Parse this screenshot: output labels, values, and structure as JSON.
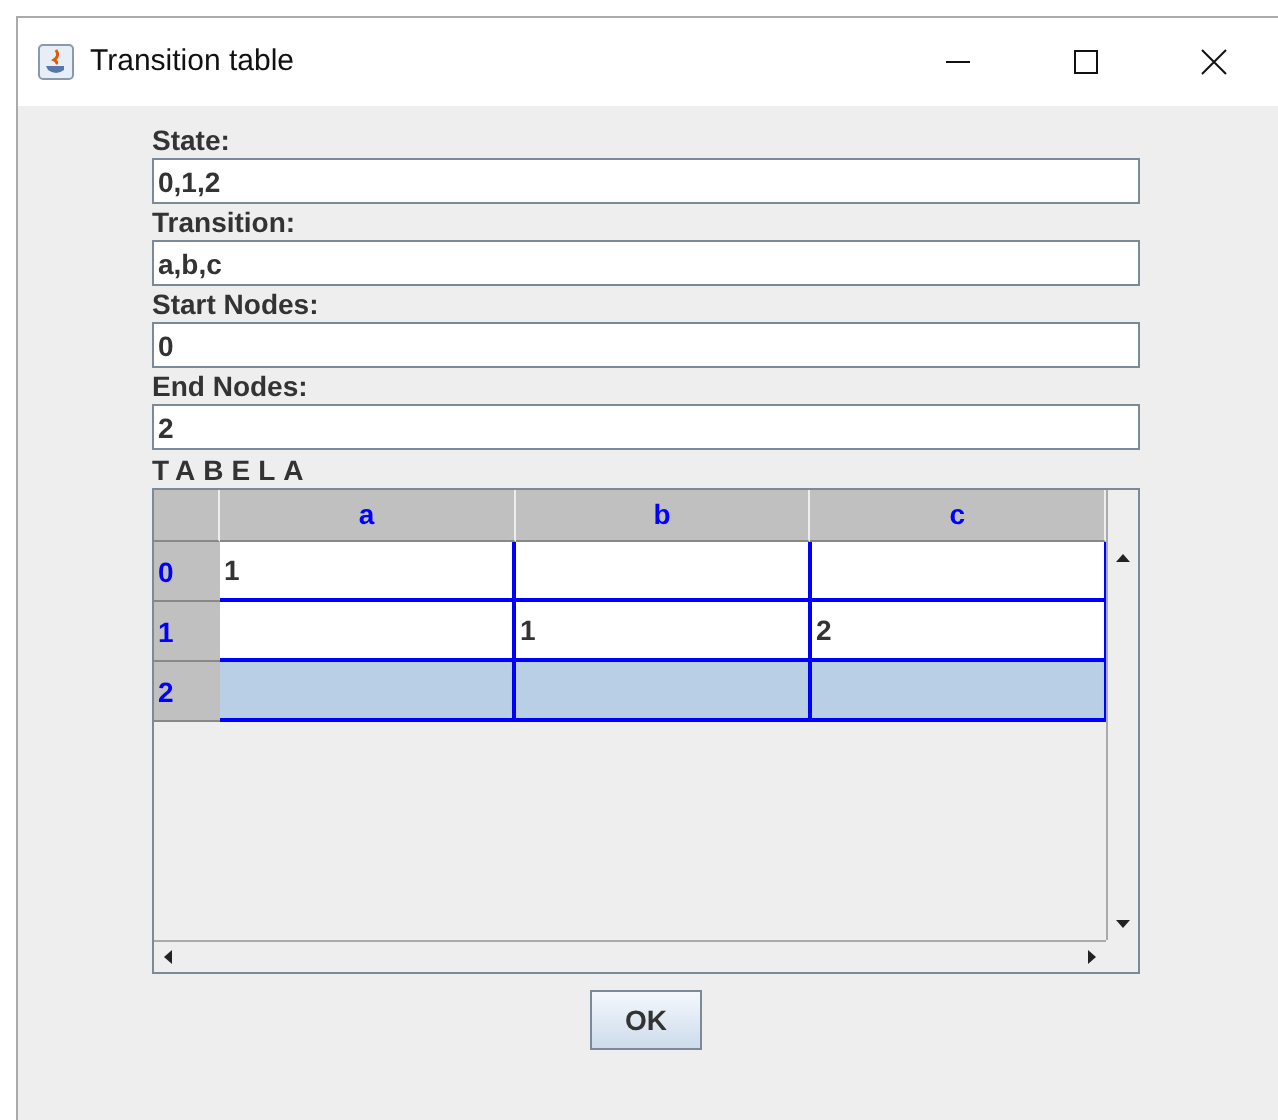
{
  "window": {
    "title": "Transition table"
  },
  "fields": [
    {
      "label": "State:",
      "value": "0,1,2"
    },
    {
      "label": "Transition:",
      "value": "a,b,c"
    },
    {
      "label": "Start Nodes:",
      "value": "0"
    },
    {
      "label": "End Nodes:",
      "value": "2"
    }
  ],
  "table": {
    "title": "TABELA",
    "columns": [
      "a",
      "b",
      "c"
    ],
    "rows": [
      {
        "header": "0",
        "cells": [
          "1",
          "",
          ""
        ],
        "selected": false
      },
      {
        "header": "1",
        "cells": [
          "",
          "1",
          "2"
        ],
        "selected": false
      },
      {
        "header": "2",
        "cells": [
          "",
          "",
          ""
        ],
        "selected": true
      }
    ]
  },
  "buttons": [
    "OK"
  ]
}
